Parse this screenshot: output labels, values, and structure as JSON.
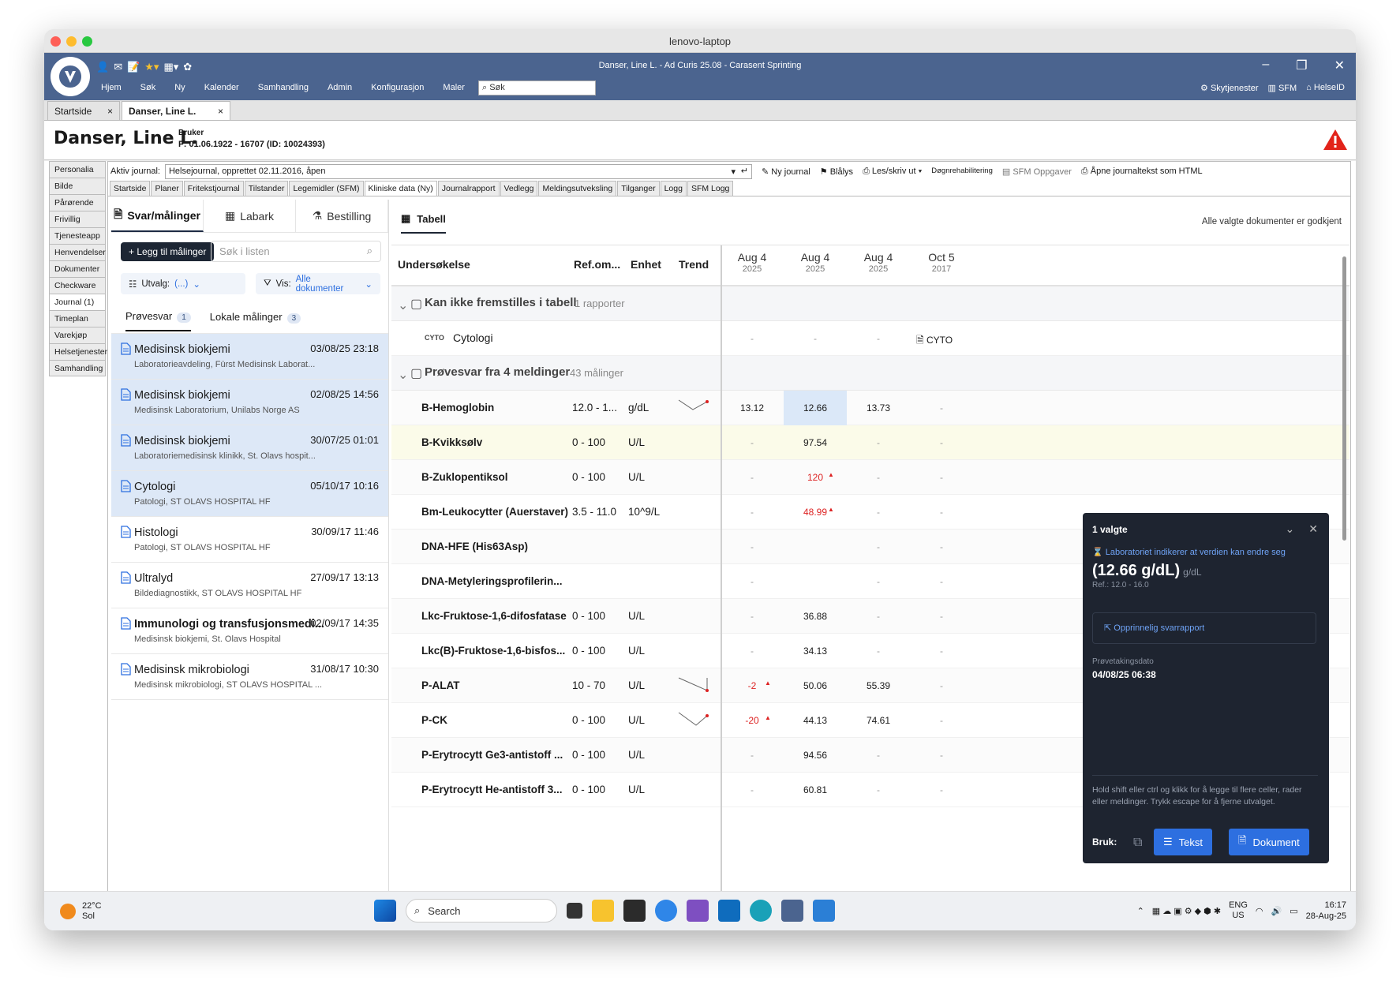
{
  "window": {
    "mac_title": "lenovo-laptop",
    "app_title": "Danser, Line L. - Ad Curis 25.08 - Carasent Sprinting"
  },
  "menu": [
    "Hjem",
    "Søk",
    "Ny",
    "Kalender",
    "Samhandling",
    "Admin",
    "Konfigurasjon",
    "Maler"
  ],
  "search_placeholder": "Søk",
  "right_links": [
    "Skytjenester",
    "SFM",
    "HelseID"
  ],
  "patient_tabs": [
    "Startside",
    "Danser, Line L."
  ],
  "patient": {
    "name": "Danser, Line L.",
    "role": "Bruker",
    "meta": "F: 01.06.1922  -  16707  (ID: 10024393)"
  },
  "side_nav": [
    "Personalia",
    "Bilde",
    "Pårørende",
    "Frivillig",
    "Tjenesteapp",
    "Henvendelser",
    "Dokumenter",
    "Checkware",
    "Journal (1)",
    "Timeplan",
    "Varekjøp",
    "Helsetjenester",
    "Samhandling"
  ],
  "journal": {
    "label": "Aktiv journal:",
    "value": "Helsejournal, opprettet 02.11.2016, åpen",
    "tools": [
      "Ny journal",
      "Blålys",
      "Les/skriv ut",
      "Døgnrehabilitering",
      "SFM Oppgaver",
      "Åpne journaltekst som HTML"
    ]
  },
  "sub_tabs": [
    "Startside",
    "Planer",
    "Fritekstjournal",
    "Tilstander",
    "Legemidler (SFM)",
    "Kliniske data (Ny)",
    "Journalrapport",
    "Vedlegg",
    "Meldingsutveksling",
    "Tilganger",
    "Logg",
    "SFM Logg"
  ],
  "left_tabs": [
    "Svar/målinger",
    "Labark",
    "Bestilling"
  ],
  "add_button": "+ Legg til målinger",
  "list_search": "Søk i listen",
  "filter": {
    "utvalg_label": "Utvalg:",
    "utvalg_value": "(...)",
    "vis_label": "Vis:",
    "vis_value": "Alle dokumenter"
  },
  "inner_tabs": [
    {
      "label": "Prøvesvar",
      "count": "1"
    },
    {
      "label": "Lokale målinger",
      "count": "3"
    }
  ],
  "documents": [
    {
      "title": "Medisinsk biokjemi",
      "date": "03/08/25 23:18",
      "sub": "Laboratorieavdeling, Fürst Medisinsk Laborat..."
    },
    {
      "title": "Medisinsk biokjemi",
      "date": "02/08/25 14:56",
      "sub": "Medisinsk Laboratorium, Unilabs Norge AS"
    },
    {
      "title": "Medisinsk biokjemi",
      "date": "30/07/25 01:01",
      "sub": "Laboratoriemedisinsk klinikk, St. Olavs hospit..."
    },
    {
      "title": "Cytologi",
      "date": "05/10/17 10:16",
      "sub": "Patologi, ST OLAVS HOSPITAL HF"
    },
    {
      "title": "Histologi",
      "date": "30/09/17 11:46",
      "sub": "Patologi, ST OLAVS HOSPITAL HF"
    },
    {
      "title": "Ultralyd",
      "date": "27/09/17 13:13",
      "sub": "Bildediagnostikk, ST OLAVS HOSPITAL HF"
    },
    {
      "title": "Immunologi og transfusjonsmedi...",
      "date": "02/09/17 14:35",
      "sub": "Medisinsk biokjemi, St. Olavs Hospital"
    },
    {
      "title": "Medisinsk mikrobiologi",
      "date": "31/08/17 10:30",
      "sub": "Medisinsk mikrobiologi, ST OLAVS HOSPITAL ..."
    }
  ],
  "table_tab": "Tabell",
  "approved_note": "Alle valgte dokumenter er godkjent",
  "columns": {
    "exam": "Undersøkelse",
    "ref": "Ref.om...",
    "unit": "Enhet",
    "trend": "Trend"
  },
  "dates": [
    {
      "d": "Aug 4",
      "y": "2025"
    },
    {
      "d": "Aug 4",
      "y": "2025"
    },
    {
      "d": "Aug 4",
      "y": "2025"
    },
    {
      "d": "Oct 5",
      "y": "2017"
    }
  ],
  "group1": {
    "title": "Kan ikke fremstilles i tabell",
    "count": "1 rapporter",
    "row_tag": "CYTO",
    "row_name": "Cytologi",
    "doc_label": "CYTO"
  },
  "group2": {
    "title": "Prøvesvar fra 4 meldinger",
    "count": "43 målinger"
  },
  "rows": [
    {
      "name": "B-Hemoglobin",
      "ref": "12.0 - 1...",
      "unit": "g/dL",
      "v": [
        "13.12",
        "12.66",
        "13.73",
        "-"
      ]
    },
    {
      "name": "B-Kvikksølv",
      "ref": "0 - 100",
      "unit": "U/L",
      "v": [
        "-",
        "97.54",
        "-",
        "-"
      ]
    },
    {
      "name": "B-Zuklopentiksol",
      "ref": "0 - 100",
      "unit": "U/L",
      "v": [
        "-",
        "120",
        "-",
        "-"
      ]
    },
    {
      "name": "Bm-Leukocytter (Auerstaver)",
      "ref": "3.5 - 11.0",
      "unit": "10^9/L",
      "v": [
        "-",
        "48.99",
        "-",
        "-"
      ]
    },
    {
      "name": "DNA-HFE (His63Asp)",
      "ref": "",
      "unit": "",
      "v": [
        "-",
        "",
        "-",
        "-"
      ]
    },
    {
      "name": "DNA-Metyleringsprofilerin...",
      "ref": "",
      "unit": "",
      "v": [
        "-",
        "",
        "-",
        "-"
      ]
    },
    {
      "name": "Lkc-Fruktose-1,6-difosfatase",
      "ref": "0 - 100",
      "unit": "U/L",
      "v": [
        "-",
        "36.88",
        "-",
        "-"
      ]
    },
    {
      "name": "Lkc(B)-Fruktose-1,6-bisfos...",
      "ref": "0 - 100",
      "unit": "U/L",
      "v": [
        "-",
        "34.13",
        "-",
        "-"
      ]
    },
    {
      "name": "P-ALAT",
      "ref": "10 - 70",
      "unit": "U/L",
      "v": [
        "-2",
        "50.06",
        "55.39",
        "-"
      ]
    },
    {
      "name": "P-CK",
      "ref": "0 - 100",
      "unit": "U/L",
      "v": [
        "-20",
        "44.13",
        "74.61",
        "-"
      ]
    },
    {
      "name": "P-Erytrocytt Ge3-antistoff ...",
      "ref": "0 - 100",
      "unit": "U/L",
      "v": [
        "-",
        "94.56",
        "-",
        "-"
      ]
    },
    {
      "name": "P-Erytrocytt He-antistoff 3...",
      "ref": "0 - 100",
      "unit": "U/L",
      "v": [
        "-",
        "60.81",
        "-",
        "-"
      ]
    }
  ],
  "popup": {
    "header": "1 valgte",
    "notice": "Laboratoriet indikerer at verdien kan endre seg",
    "value": "(12.66 g/dL)",
    "unit": "g/dL",
    "ref": "Ref.: 12.0 - 16.0",
    "report_link": "Opprinnelig svarrapport",
    "date_label": "Prøvetakingsdato",
    "date_value": "04/08/25 06:38",
    "hint": "Hold shift eller ctrl og klikk for å legge til flere celler, rader eller meldinger. Trykk escape for å fjerne utvalget.",
    "use_label": "Bruk:",
    "btn_text": "Tekst",
    "btn_doc": "Dokument"
  },
  "taskbar": {
    "temp": "22°C",
    "weather": "Sol",
    "search": "Search",
    "lang1": "ENG",
    "lang2": "US",
    "time": "16:17",
    "date": "28-Aug-25"
  }
}
